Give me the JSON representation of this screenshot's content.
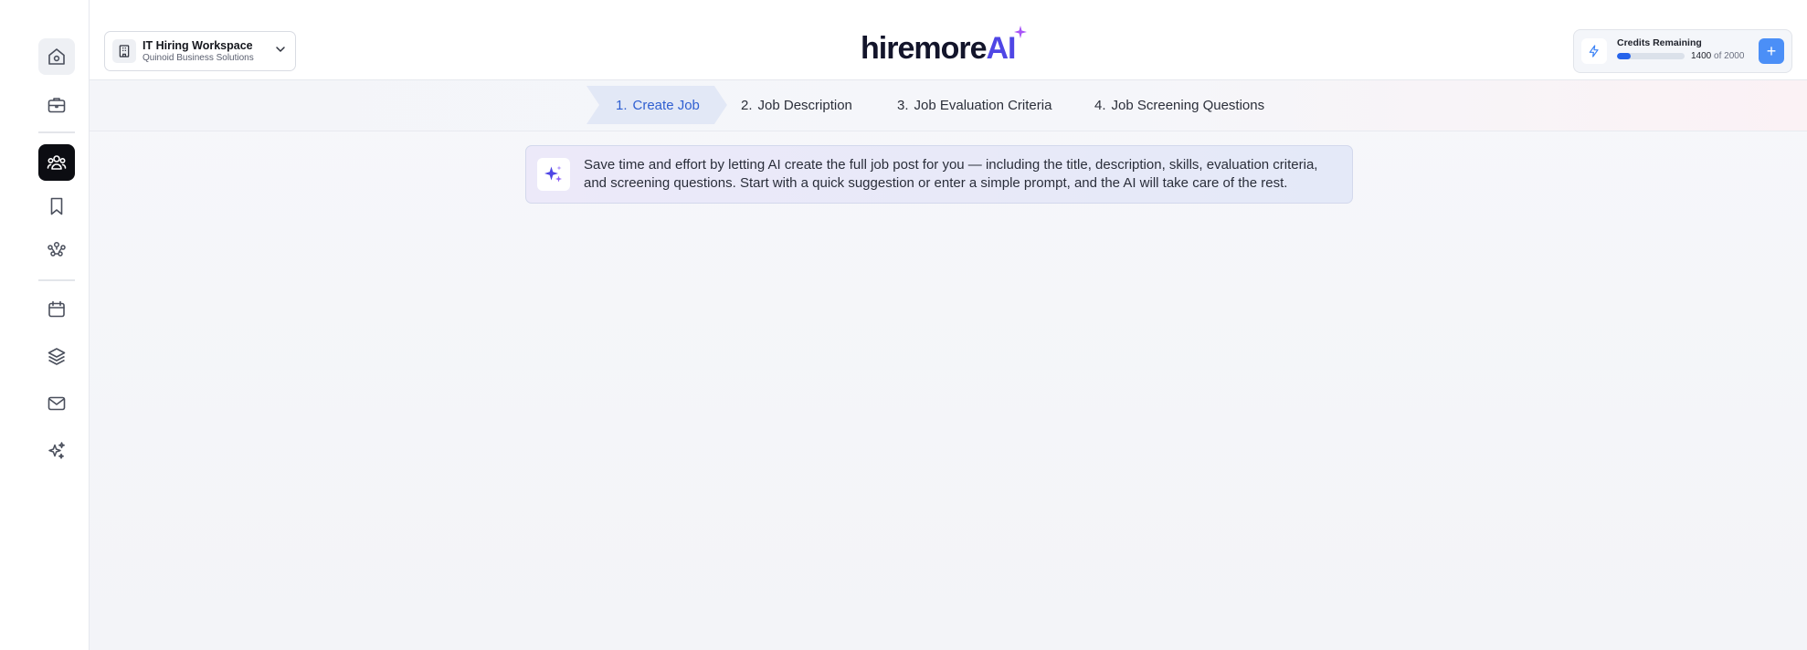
{
  "sidebar": {
    "items": [
      {
        "icon": "home-icon"
      },
      {
        "icon": "briefcase-icon"
      },
      {
        "icon": "candidates-icon"
      },
      {
        "icon": "bookmark-icon"
      },
      {
        "icon": "team-icon"
      },
      {
        "icon": "calendar-icon"
      },
      {
        "icon": "layers-icon"
      },
      {
        "icon": "mail-icon"
      },
      {
        "icon": "ai-sparkle-icon"
      }
    ],
    "active_index": 2
  },
  "workspace": {
    "title": "IT Hiring Workspace",
    "subtitle": "Quinoid Business Solutions"
  },
  "logo": {
    "text_main": "hiremore",
    "text_ai": "AI"
  },
  "credits": {
    "label": "Credits Remaining",
    "used": "1400",
    "of_label": "of",
    "total": "2000",
    "add_label": "+"
  },
  "stepper": {
    "steps": [
      {
        "num": "1.",
        "label": "Create Job"
      },
      {
        "num": "2.",
        "label": "Job Description"
      },
      {
        "num": "3.",
        "label": "Job Evaluation Criteria"
      },
      {
        "num": "4.",
        "label": "Job Screening Questions"
      }
    ],
    "active_index": 0
  },
  "info_banner": {
    "text": "Save time and effort by letting AI create the full job post for you — including the title, description, skills, evaluation criteria, and screening questions. Start with a quick suggestion or enter a simple prompt, and the AI will take care of the rest."
  },
  "colors": {
    "accent": "#2563eb",
    "active_step_text": "#2f5fd1",
    "active_step_bg": "#e2e8f6",
    "sidebar_active_bg": "#0c0d12",
    "logo_ai": "#4f46e5"
  }
}
